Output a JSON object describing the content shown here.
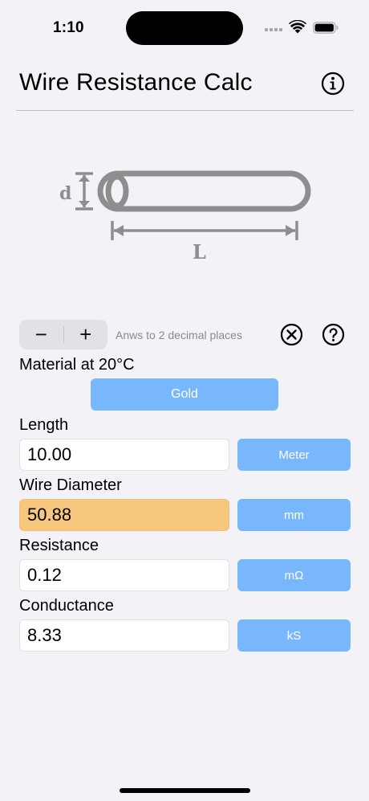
{
  "status_bar": {
    "time": "1:10"
  },
  "header": {
    "title": "Wire Resistance Calc"
  },
  "diagram": {
    "diameter_label": "d",
    "length_label": "L"
  },
  "controls": {
    "decrement_label": "−",
    "increment_label": "+",
    "precision_text": "Anws to 2 decimal places"
  },
  "material": {
    "label": "Material at 20°C",
    "value": "Gold"
  },
  "fields": {
    "length": {
      "label": "Length",
      "value": "10.00",
      "unit": "Meter"
    },
    "diameter": {
      "label": "Wire Diameter",
      "value": "50.88",
      "unit": "mm"
    },
    "resistance": {
      "label": "Resistance",
      "value": "0.12",
      "unit": "mΩ"
    },
    "conductance": {
      "label": "Conductance",
      "value": "8.33",
      "unit": "kS"
    }
  },
  "colors": {
    "accent": "#78b7fb",
    "highlight": "#f7c77d",
    "background": "#f2f2f7",
    "diagram_gray": "#8e8e8e"
  }
}
